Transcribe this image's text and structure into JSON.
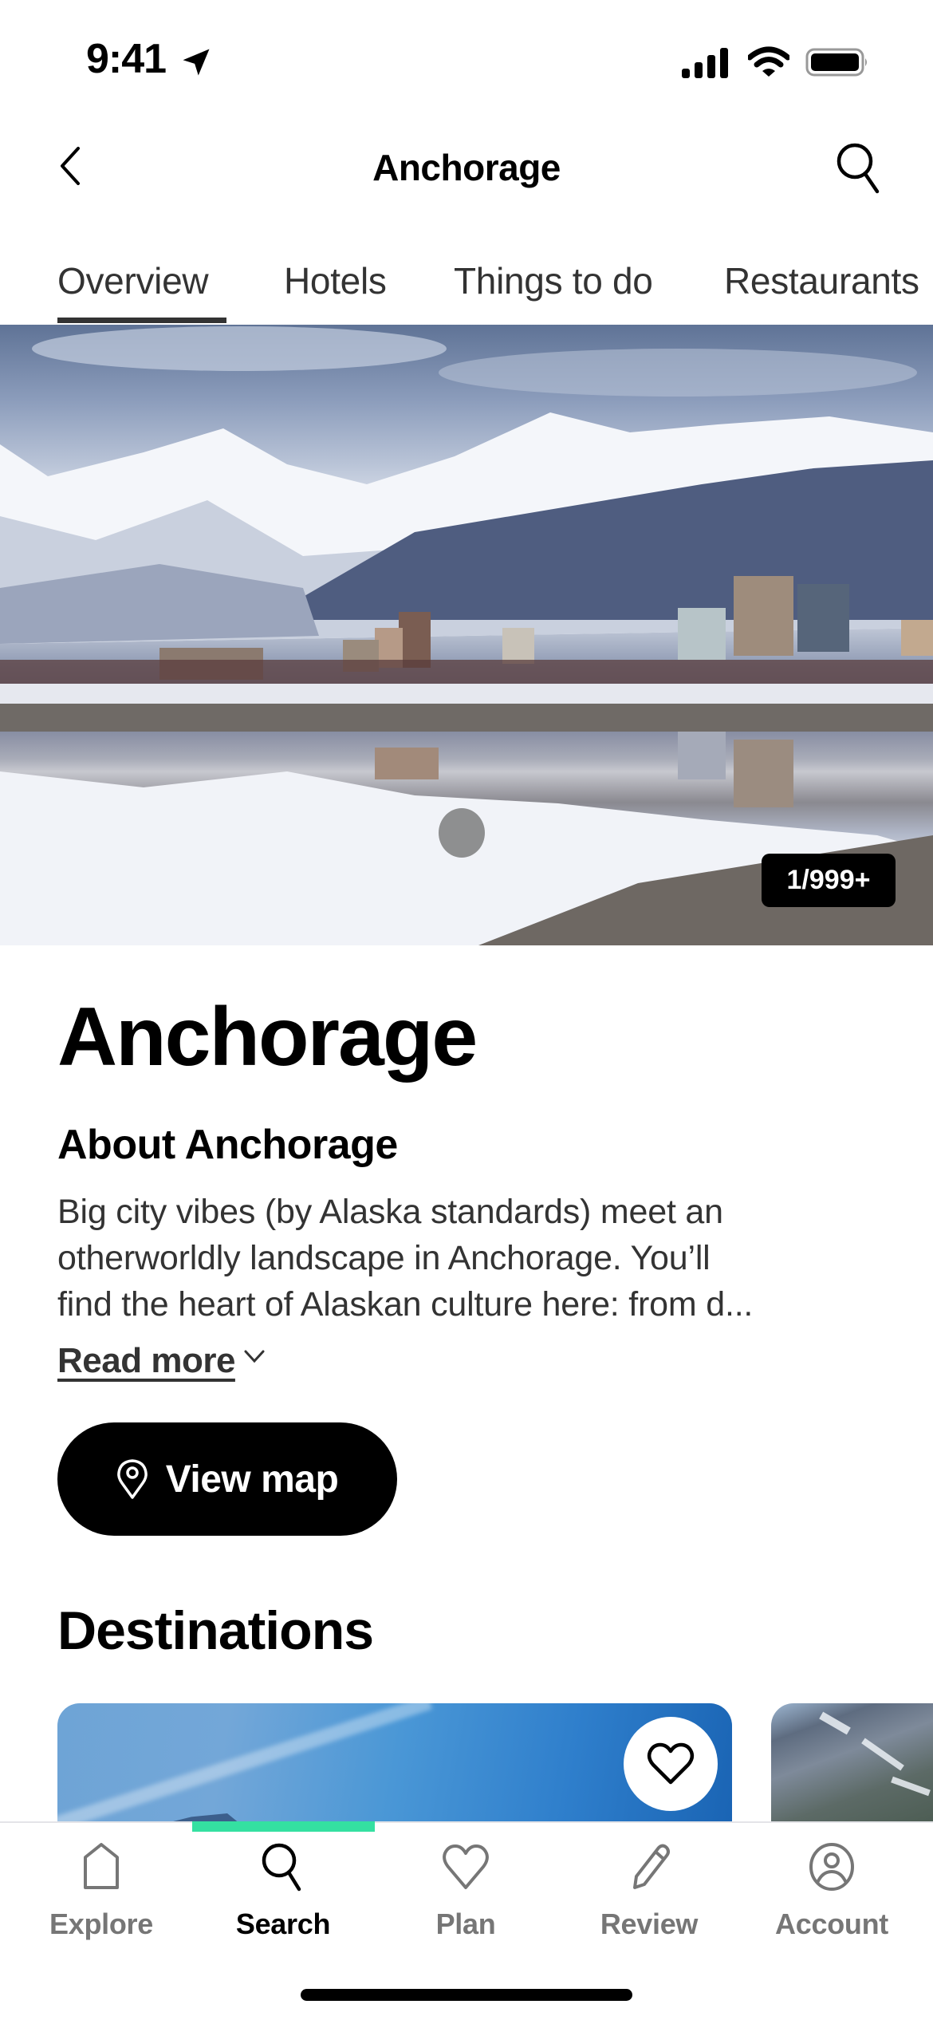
{
  "status_bar": {
    "time": "9:41",
    "icons": [
      "location-arrow-icon",
      "cellular-signal-icon",
      "wifi-icon",
      "battery-icon"
    ]
  },
  "nav": {
    "title": "Anchorage",
    "back_icon": "chevron-left-icon",
    "search_icon": "search-icon"
  },
  "tabs": [
    {
      "label": "Overview",
      "active": true
    },
    {
      "label": "Hotels",
      "active": false
    },
    {
      "label": "Things to do",
      "active": false
    },
    {
      "label": "Restaurants",
      "active": false
    }
  ],
  "hero": {
    "photo_counter": "1/999+",
    "alt": "Anchorage skyline with snowy mountains reflected in water"
  },
  "content": {
    "title": "Anchorage",
    "about_heading": "About Anchorage",
    "about_lines": [
      "Big city vibes (by Alaska standards) meet an",
      "otherworldly landscape in Anchorage. You’ll",
      "find the heart of Alaskan culture here: from d..."
    ],
    "read_more_label": "Read more",
    "view_map_label": "View map"
  },
  "destinations": {
    "heading": "Destinations",
    "cards": [
      {
        "favorite_icon": "heart-outline-icon"
      },
      {}
    ]
  },
  "bottom_tabs": [
    {
      "label": "Explore",
      "icon": "home-icon",
      "active": false
    },
    {
      "label": "Search",
      "icon": "search-icon",
      "active": true
    },
    {
      "label": "Plan",
      "icon": "heart-icon",
      "active": false
    },
    {
      "label": "Review",
      "icon": "pencil-icon",
      "active": false
    },
    {
      "label": "Account",
      "icon": "account-circle-icon",
      "active": false
    }
  ],
  "colors": {
    "accent_green": "#34e0a1",
    "text_primary": "#000000",
    "text_secondary": "#333333",
    "tab_inactive": "#767676"
  }
}
